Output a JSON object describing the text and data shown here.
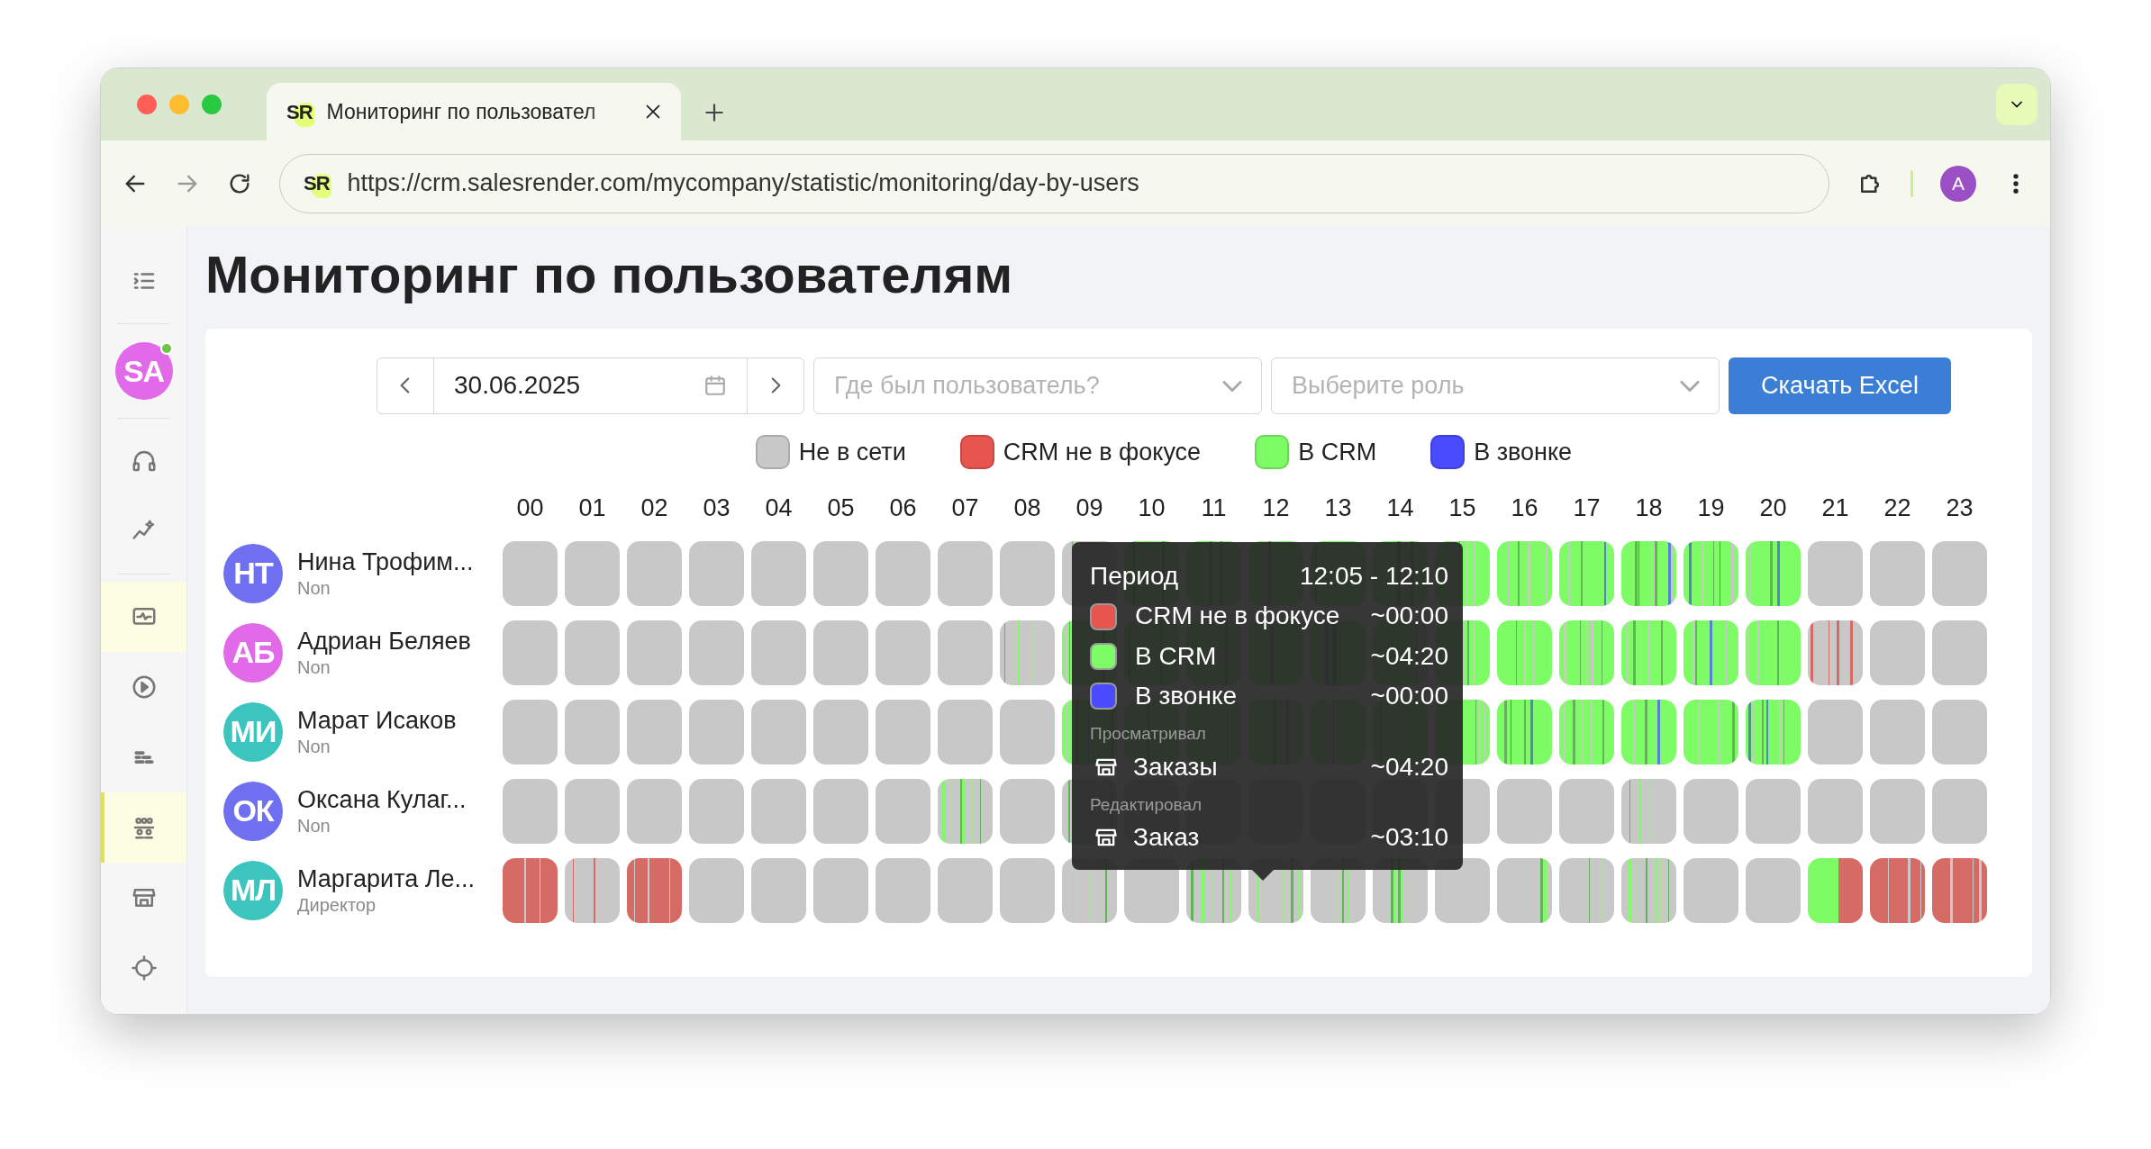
{
  "browser": {
    "tab_favicon": "SR",
    "tab_title": "Мониторинг по пользовател",
    "url_favicon": "SR",
    "url": "https://crm.salesrender.com/mycompany/statistic/monitoring/day-by-users",
    "profile_initial": "A"
  },
  "sidebar": {
    "items": [
      {
        "kind": "menu",
        "selected": false
      },
      {
        "kind": "avatar",
        "initials": "SA",
        "color": "#e06ae8",
        "online": true,
        "selected": false
      },
      {
        "kind": "headset",
        "selected": false
      },
      {
        "kind": "chart",
        "selected": false
      },
      {
        "kind": "monitor",
        "selected": true
      },
      {
        "kind": "play",
        "selected": false
      },
      {
        "kind": "bricks",
        "selected": false
      },
      {
        "kind": "users",
        "selected": true,
        "current": true
      },
      {
        "kind": "store",
        "selected": false
      },
      {
        "kind": "gear",
        "selected": false
      }
    ]
  },
  "page_title": "Мониторинг по пользователям",
  "filters": {
    "date": "30.06.2025",
    "location": {
      "placeholder": "Где был пользователь?"
    },
    "role": {
      "placeholder": "Выберите роль"
    },
    "export_button": "Скачать Excel"
  },
  "legend": [
    {
      "label": "Не в сети",
      "color": "#c8c8c8"
    },
    {
      "label": "CRM не в фокусе",
      "color": "#e8554e"
    },
    {
      "label": "В CRM",
      "color": "#7dfc66"
    },
    {
      "label": "В звонке",
      "color": "#4a4aff"
    }
  ],
  "hours": [
    "00",
    "01",
    "02",
    "03",
    "04",
    "05",
    "06",
    "07",
    "08",
    "09",
    "10",
    "11",
    "12",
    "13",
    "14",
    "15",
    "16",
    "17",
    "18",
    "19",
    "20",
    "21",
    "22",
    "23"
  ],
  "users": [
    {
      "initials": "НТ",
      "color": "#6f70f0",
      "name": "Нина Трофим...",
      "role": "Non",
      "cells": [
        {
          "kind": "offline"
        },
        {
          "kind": "offline"
        },
        {
          "kind": "offline"
        },
        {
          "kind": "offline"
        },
        {
          "kind": "offline"
        },
        {
          "kind": "offline"
        },
        {
          "kind": "offline"
        },
        {
          "kind": "offline"
        },
        {
          "kind": "offline"
        },
        {
          "kind": "partial"
        },
        {
          "kind": "crm"
        },
        {
          "kind": "crm"
        },
        {
          "kind": "crm"
        },
        {
          "kind": "crm"
        },
        {
          "kind": "crm"
        },
        {
          "kind": "crm"
        },
        {
          "kind": "crm"
        },
        {
          "kind": "crm_call"
        },
        {
          "kind": "crm_call"
        },
        {
          "kind": "crm_call"
        },
        {
          "kind": "crm_call"
        },
        {
          "kind": "offline"
        },
        {
          "kind": "offline"
        },
        {
          "kind": "offline"
        }
      ]
    },
    {
      "initials": "АБ",
      "color": "#e06ae8",
      "name": "Адриан Беляев",
      "role": "Non",
      "cells": [
        {
          "kind": "offline"
        },
        {
          "kind": "offline"
        },
        {
          "kind": "offline"
        },
        {
          "kind": "offline"
        },
        {
          "kind": "offline"
        },
        {
          "kind": "offline"
        },
        {
          "kind": "offline"
        },
        {
          "kind": "offline"
        },
        {
          "kind": "partial"
        },
        {
          "kind": "crm"
        },
        {
          "kind": "crm"
        },
        {
          "kind": "crm"
        },
        {
          "kind": "crm"
        },
        {
          "kind": "crm_call"
        },
        {
          "kind": "crm"
        },
        {
          "kind": "crm"
        },
        {
          "kind": "crm"
        },
        {
          "kind": "crm"
        },
        {
          "kind": "crm"
        },
        {
          "kind": "crm_call"
        },
        {
          "kind": "crm"
        },
        {
          "kind": "mixed_unfocused"
        },
        {
          "kind": "offline"
        },
        {
          "kind": "offline"
        }
      ]
    },
    {
      "initials": "МИ",
      "color": "#3cc4be",
      "name": "Марат Исаков",
      "role": "Non",
      "cells": [
        {
          "kind": "offline"
        },
        {
          "kind": "offline"
        },
        {
          "kind": "offline"
        },
        {
          "kind": "offline"
        },
        {
          "kind": "offline"
        },
        {
          "kind": "offline"
        },
        {
          "kind": "offline"
        },
        {
          "kind": "offline"
        },
        {
          "kind": "offline"
        },
        {
          "kind": "crm_call"
        },
        {
          "kind": "crm"
        },
        {
          "kind": "crm"
        },
        {
          "kind": "crm"
        },
        {
          "kind": "crm"
        },
        {
          "kind": "crm"
        },
        {
          "kind": "crm"
        },
        {
          "kind": "crm_call"
        },
        {
          "kind": "crm"
        },
        {
          "kind": "crm_call"
        },
        {
          "kind": "crm"
        },
        {
          "kind": "crm_call"
        },
        {
          "kind": "offline"
        },
        {
          "kind": "offline"
        },
        {
          "kind": "offline"
        }
      ]
    },
    {
      "initials": "ОК",
      "color": "#6f70f0",
      "name": "Оксана Кулаг...",
      "role": "Non",
      "cells": [
        {
          "kind": "offline"
        },
        {
          "kind": "offline"
        },
        {
          "kind": "offline"
        },
        {
          "kind": "offline"
        },
        {
          "kind": "offline"
        },
        {
          "kind": "offline"
        },
        {
          "kind": "offline"
        },
        {
          "kind": "partial"
        },
        {
          "kind": "offline"
        },
        {
          "kind": "partial"
        },
        {
          "kind": "offline"
        },
        {
          "kind": "offline"
        },
        {
          "kind": "offline"
        },
        {
          "kind": "offline"
        },
        {
          "kind": "offline"
        },
        {
          "kind": "offline"
        },
        {
          "kind": "offline"
        },
        {
          "kind": "offline"
        },
        {
          "kind": "partial"
        },
        {
          "kind": "offline"
        },
        {
          "kind": "offline"
        },
        {
          "kind": "offline"
        },
        {
          "kind": "offline"
        },
        {
          "kind": "offline"
        }
      ]
    },
    {
      "initials": "МЛ",
      "color": "#3cc4be",
      "name": "Маргарита Ле...",
      "role": "Директор",
      "cells": [
        {
          "kind": "unfocused"
        },
        {
          "kind": "mixed_unfocused"
        },
        {
          "kind": "unfocused"
        },
        {
          "kind": "offline"
        },
        {
          "kind": "offline"
        },
        {
          "kind": "offline"
        },
        {
          "kind": "offline"
        },
        {
          "kind": "offline"
        },
        {
          "kind": "offline"
        },
        {
          "kind": "partial"
        },
        {
          "kind": "offline"
        },
        {
          "kind": "partial"
        },
        {
          "kind": "partial"
        },
        {
          "kind": "partial"
        },
        {
          "kind": "partial"
        },
        {
          "kind": "offline"
        },
        {
          "kind": "partial"
        },
        {
          "kind": "partial"
        },
        {
          "kind": "partial"
        },
        {
          "kind": "offline"
        },
        {
          "kind": "offline"
        },
        {
          "kind": "crm_unfocused"
        },
        {
          "kind": "unfocused"
        },
        {
          "kind": "unfocused"
        }
      ]
    }
  ],
  "tooltip": {
    "title": "Период",
    "period": "12:05 - 12:10",
    "stats": [
      {
        "label": "CRM не в фокусе",
        "color": "#e8554e",
        "value": "~00:00"
      },
      {
        "label": "В CRM",
        "color": "#7dfc66",
        "value": "~04:20"
      },
      {
        "label": "В звонке",
        "color": "#4a4aff",
        "value": "~00:00"
      }
    ],
    "sections": [
      {
        "title": "Просматривал",
        "items": [
          {
            "label": "Заказы",
            "value": "~04:20"
          }
        ]
      },
      {
        "title": "Редактировал",
        "items": [
          {
            "label": "Заказ",
            "value": "~03:10"
          }
        ]
      }
    ]
  }
}
